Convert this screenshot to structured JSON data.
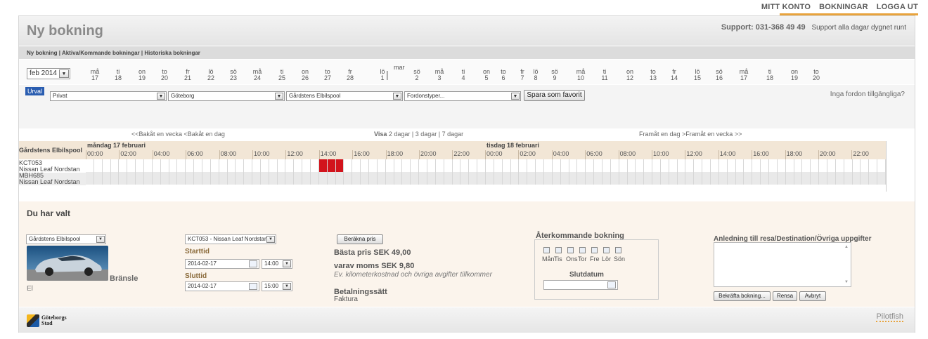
{
  "topnav": {
    "account": "MITT KONTO",
    "bookings": "BOKNINGAR",
    "logout": "LOGGA UT"
  },
  "header": {
    "title": "Ny bokning",
    "support_label": "Support: 031-368 49 49",
    "support_sub": "Support alla dagar dygnet runt"
  },
  "subnav": {
    "new": "Ny bokning",
    "active": "Aktiva/Kommande bokningar",
    "history": "Historiska bokningar",
    "sep": " | "
  },
  "datestrip": {
    "month_select": "feb 2014",
    "month_mark": "mar",
    "days": [
      {
        "d": "må",
        "n": "17"
      },
      {
        "d": "ti",
        "n": "18"
      },
      {
        "d": "on",
        "n": "19"
      },
      {
        "d": "to",
        "n": "20"
      },
      {
        "d": "fr",
        "n": "21"
      },
      {
        "d": "lö",
        "n": "22"
      },
      {
        "d": "sö",
        "n": "23"
      },
      {
        "d": "må",
        "n": "24"
      },
      {
        "d": "ti",
        "n": "25"
      },
      {
        "d": "on",
        "n": "26"
      },
      {
        "d": "to",
        "n": "27"
      },
      {
        "d": "fr",
        "n": "28"
      },
      {
        "d": "lö",
        "n": "1"
      },
      {
        "d": "sö",
        "n": "2"
      },
      {
        "d": "må",
        "n": "3"
      },
      {
        "d": "ti",
        "n": "4"
      },
      {
        "d": "on",
        "n": "5"
      },
      {
        "d": "to",
        "n": "6"
      },
      {
        "d": "fr",
        "n": "7"
      },
      {
        "d": "lö",
        "n": "8"
      },
      {
        "d": "sö",
        "n": "9"
      },
      {
        "d": "må",
        "n": "10"
      },
      {
        "d": "ti",
        "n": "11"
      },
      {
        "d": "on",
        "n": "12"
      },
      {
        "d": "to",
        "n": "13"
      },
      {
        "d": "fr",
        "n": "14"
      },
      {
        "d": "lö",
        "n": "15"
      },
      {
        "d": "sö",
        "n": "16"
      },
      {
        "d": "må",
        "n": "17"
      },
      {
        "d": "ti",
        "n": "18"
      },
      {
        "d": "on",
        "n": "19"
      },
      {
        "d": "to",
        "n": "20"
      }
    ]
  },
  "filter": {
    "urval": "Urval",
    "type": "Privat",
    "city": "Göteborg",
    "pool": "Gårdstens Elbilspool",
    "vehicle_type": "Fordonstyper...",
    "favorite_button": "Spara som favorit",
    "no_cars_link": "Inga fordon tillgängliga?"
  },
  "weeknav": {
    "back": "<<Bakåt en vecka <Bakåt en dag",
    "view_label": "Visa",
    "view_options": "2 dagar | 3 dagar | 7 dagar",
    "forward": "Framåt en dag >Framåt en vecka >>"
  },
  "calendar": {
    "pool_label": "Gårdstens Elbilspool",
    "day1": "måndag 17 februari",
    "day2": "tisdag 18 februari",
    "hours": [
      "00:00",
      "02:00",
      "04:00",
      "06:00",
      "08:00",
      "10:00",
      "12:00",
      "14:00",
      "16:00",
      "18:00",
      "20:00",
      "22:00"
    ],
    "rows": [
      {
        "plate": "KCT053",
        "model": "Nissan Leaf Nordstan",
        "booked_slots": [
          28,
          29,
          30
        ]
      },
      {
        "plate": "MBH685",
        "model": "Nissan Leaf Nordstan",
        "booked_slots": []
      }
    ]
  },
  "panel": {
    "title": "Du har valt",
    "pool_select": "Gårdstens Elbilspool",
    "fuel_label": "Bränsle",
    "fuel_value": "El",
    "car_select": "KCT053 - Nissan Leaf Nordstan",
    "start_label": "Starttid",
    "start_date": "2014-02-17",
    "start_time": "14:00",
    "end_label": "Sluttid",
    "end_date": "2014-02-17",
    "end_time": "15:00",
    "calc_button": "Beräkna pris",
    "best_price": "Bästa pris SEK 49,00",
    "vat": "varav moms SEK 9,80",
    "extra_note": "Ev. kilometerkostnad och övriga avgifter tillkommer",
    "payment_label": "Betalningssätt",
    "payment_value": "Faktura",
    "recurring_title": "Återkommande bokning",
    "weekdays": [
      "Mån",
      "Tis",
      "Ons",
      "Tor",
      "Fre",
      "Lör",
      "Sön"
    ],
    "end_date_label": "Slutdatum",
    "notes_label": "Anledning till resa/Destination/Övriga uppgifter",
    "confirm_button": "Bekräfta bokning...",
    "clear_button": "Rensa",
    "cancel_button": "Avbryt"
  },
  "footer": {
    "logo_line1": "Göteborgs",
    "logo_line2": "Stad",
    "brand": "Pilotfish"
  }
}
